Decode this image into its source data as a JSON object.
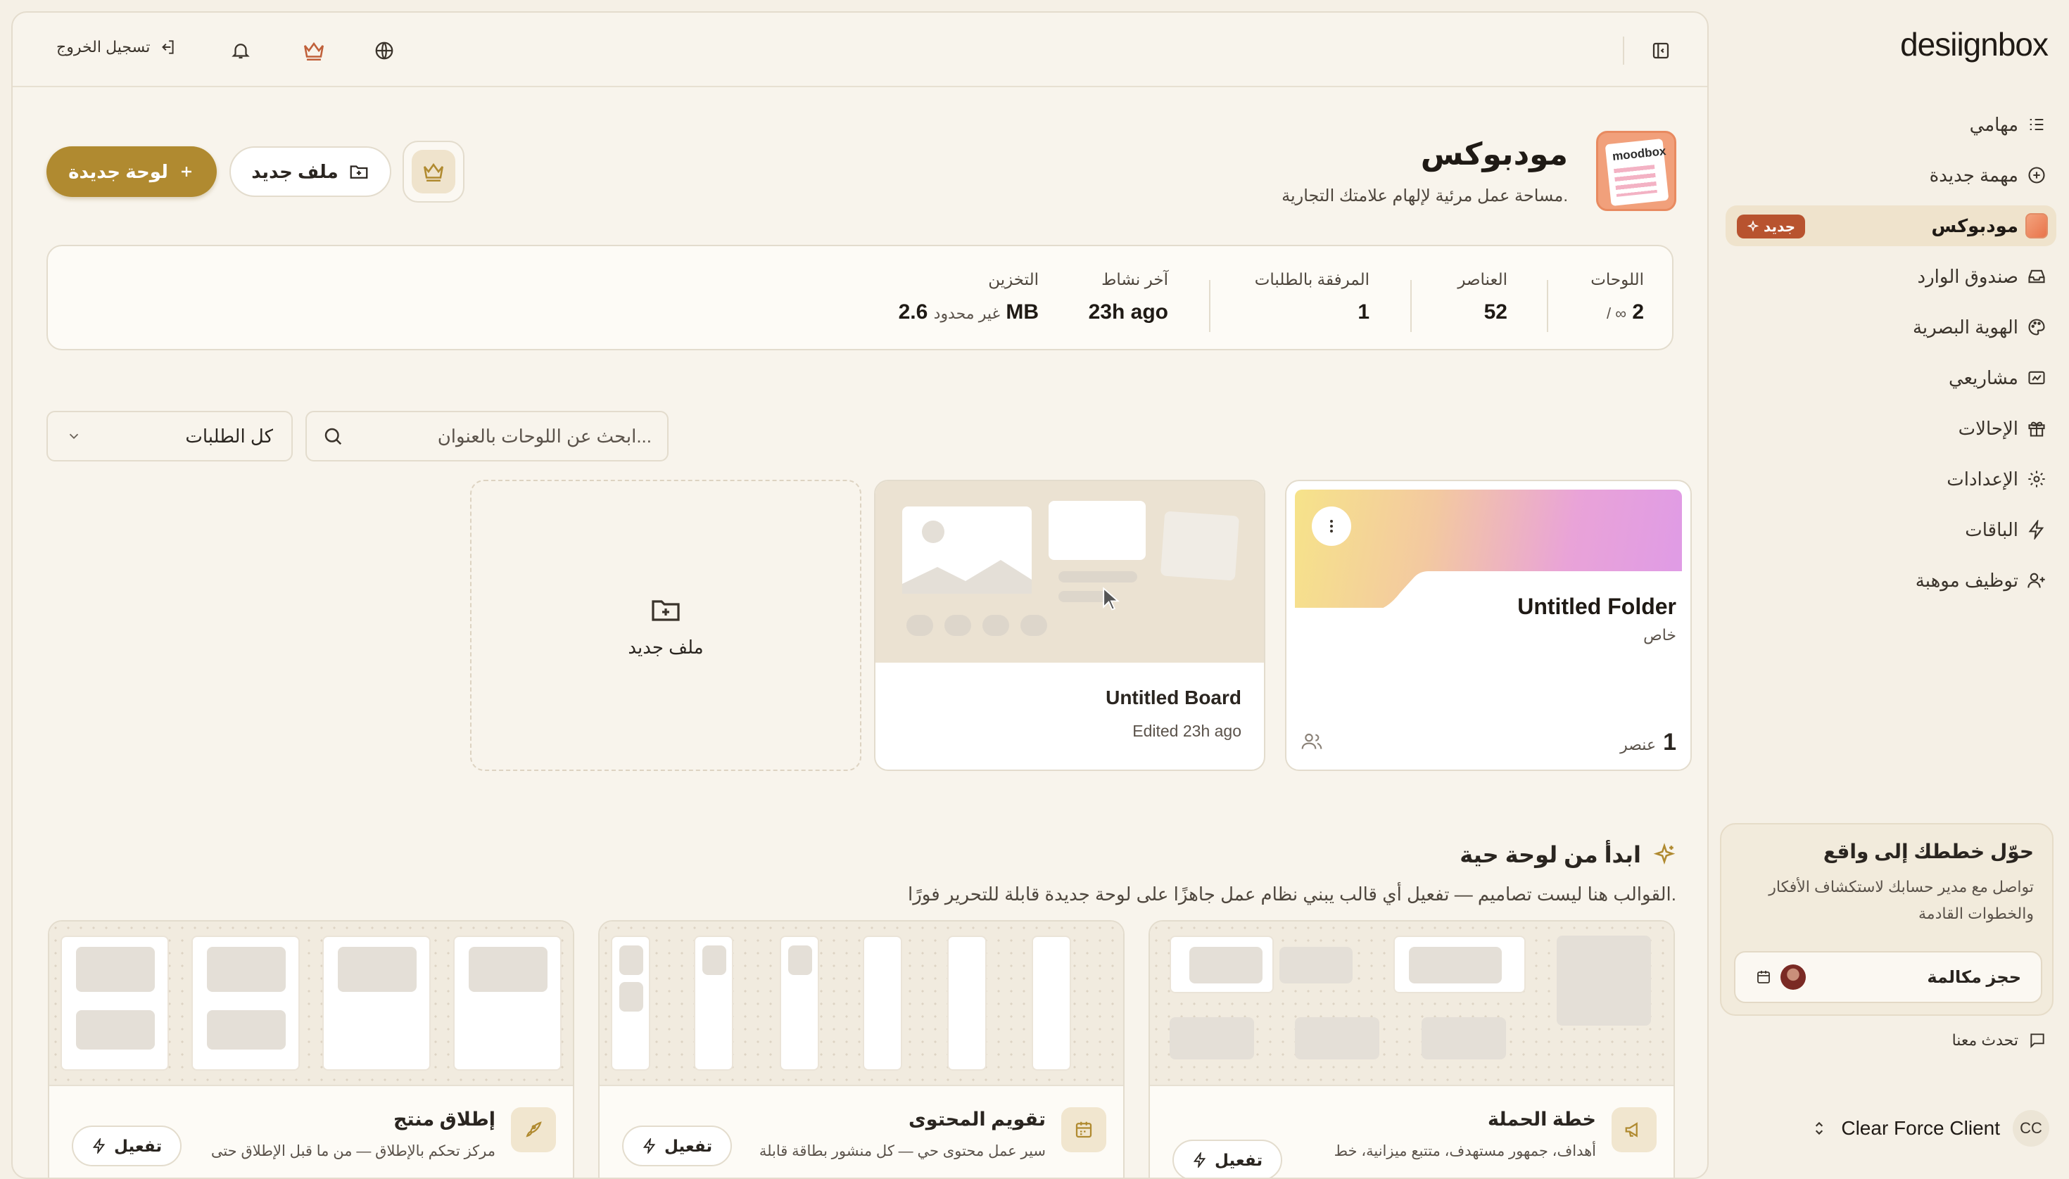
{
  "sidebar": {
    "logo": "desiignbox",
    "items": [
      {
        "label": "مهامي",
        "icon": "tasks-icon"
      },
      {
        "label": "مهمة جديدة",
        "icon": "plus-circle-icon"
      },
      {
        "label": "مودبوكس",
        "icon": "moodbox-icon",
        "badge": "جديد",
        "active": true
      },
      {
        "label": "صندوق الوارد",
        "icon": "inbox-icon"
      },
      {
        "label": "الهوية البصرية",
        "icon": "palette-icon"
      },
      {
        "label": "مشاريعي",
        "icon": "projects-icon"
      },
      {
        "label": "الإحالات",
        "icon": "gift-icon"
      },
      {
        "label": "الإعدادات",
        "icon": "gear-icon"
      },
      {
        "label": "الباقات",
        "icon": "bolt-icon"
      },
      {
        "label": "توظيف موهبة",
        "icon": "user-plus-icon"
      }
    ],
    "promo": {
      "title": "حوّل خططك إلى واقع",
      "text": "تواصل مع مدير حسابك لاستكشاف الأفكار والخطوات القادمة",
      "button": "حجز مكالمة"
    },
    "chat_link": "تحدث معنا",
    "account": {
      "initials": "CC",
      "name": "Clear Force Client"
    }
  },
  "topbar": {
    "logout": "تسجيل الخروج"
  },
  "header": {
    "title": "مودبوكس",
    "subtitle": "مساحة عمل مرئية لإلهام علامتك التجارية.",
    "logo_text": "moodbox",
    "new_board": "لوحة جديدة",
    "new_folder": "ملف جديد"
  },
  "stats": [
    {
      "label": "اللوحات",
      "value": "2",
      "extra": "/ ∞"
    },
    {
      "label": "العناصر",
      "value": "52",
      "extra": ""
    },
    {
      "label": "المرفقة بالطلبات",
      "value": "1",
      "extra": ""
    },
    {
      "label": "آخر نشاط",
      "value": "23h ago",
      "extra": ""
    },
    {
      "label": "التخزين",
      "value": "2.6 MB",
      "extra": "غير محدود"
    }
  ],
  "filters": {
    "requests_select": "كل الطلبات",
    "search_placeholder": "ابحث عن اللوحات بالعنوان..."
  },
  "cards": {
    "folder": {
      "title": "Untitled Folder",
      "subtitle": "خاص",
      "count": "1",
      "count_unit": "عنصر"
    },
    "board": {
      "title": "Untitled Board",
      "subtitle": "Edited 23h ago"
    },
    "new_folder": {
      "label": "ملف جديد"
    }
  },
  "templates_section": {
    "title": "ابدأ من لوحة حية",
    "subtitle": "القوالب هنا ليست تصاميم — تفعيل أي قالب يبني نظام عمل جاهزًا على لوحة جديدة قابلة للتحرير فورًا.",
    "activate_label": "تفعيل",
    "items": [
      {
        "title": "خطة الحملة",
        "desc": "أهداف، جمهور مستهدف، متتبع ميزانية، خط",
        "icon": "megaphone-icon"
      },
      {
        "title": "تقويم المحتوى",
        "desc": "سير عمل محتوى حي — كل منشور بطاقة قابلة",
        "icon": "calendar-icon"
      },
      {
        "title": "إطلاق منتج",
        "desc": "مركز تحكم بالإطلاق — من ما قبل الإطلاق حتى",
        "icon": "rocket-icon"
      }
    ]
  },
  "colors": {
    "accent": "#b08a30",
    "badge": "#b8532f",
    "background": "#f5f0e6",
    "panel": "#f8f4ec"
  }
}
